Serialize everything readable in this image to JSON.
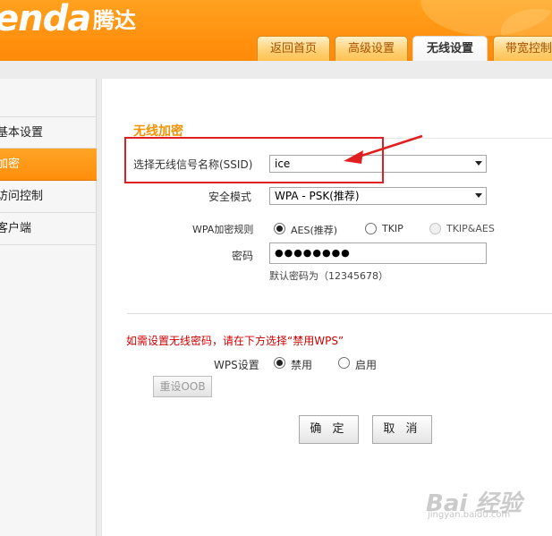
{
  "header": {
    "logo_text": "enda",
    "logo_cn": "腾达",
    "tabs": [
      {
        "label": "返回首页",
        "active": false
      },
      {
        "label": "高级设置",
        "active": false
      },
      {
        "label": "无线设置",
        "active": true
      },
      {
        "label": "带宽控制",
        "active": false
      }
    ]
  },
  "sidebar": {
    "items": [
      {
        "label": "基本设置",
        "active": false
      },
      {
        "label": "加密",
        "active": true
      },
      {
        "label": "访问控制",
        "active": false
      },
      {
        "label": "客户端",
        "active": false
      }
    ]
  },
  "main": {
    "section_title": "无线加密",
    "ssid": {
      "label": "选择无线信号名称(SSID)",
      "value": "ice"
    },
    "security_mode": {
      "label": "安全模式",
      "value": "WPA - PSK(推荐)"
    },
    "wpa_rule": {
      "label": "WPA加密规则",
      "options": [
        {
          "label": "AES(推荐)",
          "checked": true,
          "disabled": false
        },
        {
          "label": "TKIP",
          "checked": false,
          "disabled": false
        },
        {
          "label": "TKIP&AES",
          "checked": false,
          "disabled": true
        }
      ]
    },
    "password": {
      "label": "密码",
      "value": "●●●●●●●●",
      "hint": "默认密码为（12345678）"
    },
    "wps_hint": "如需设置无线密码，请在下方选择“禁用WPS”",
    "wps": {
      "label": "WPS设置",
      "options": [
        {
          "label": "禁用",
          "checked": true
        },
        {
          "label": "启用",
          "checked": false
        }
      ]
    },
    "reset_oob_label": "重设OOB",
    "ok_label": "确 定",
    "cancel_label": "取 消"
  },
  "watermark": {
    "text": "Bai 经验",
    "url": "jingyan.baidu.com"
  },
  "colors": {
    "accent": "#ff9210",
    "title": "#f39200",
    "warning": "#cc0000",
    "highlight": "#e02020"
  }
}
